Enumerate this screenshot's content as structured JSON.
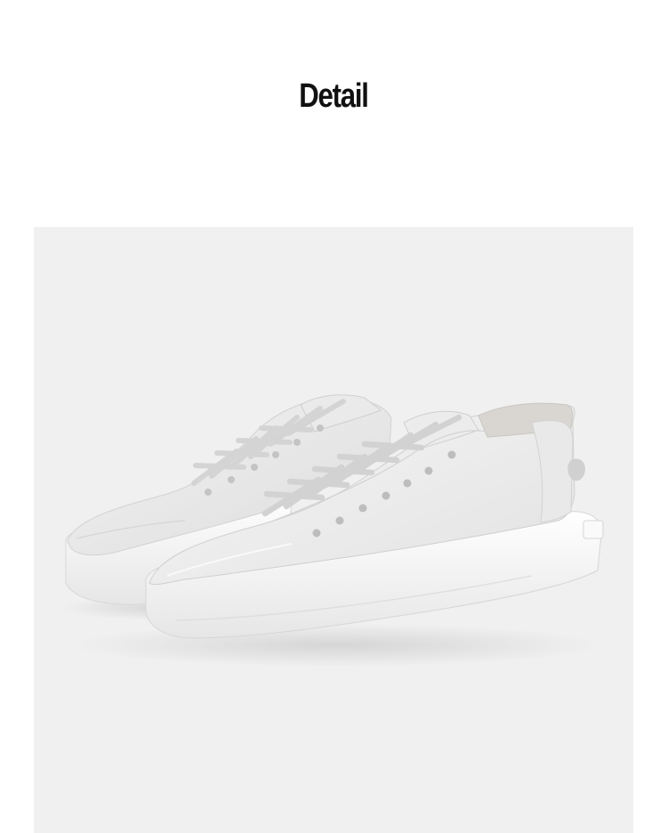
{
  "page": {
    "title": "Detail"
  },
  "product_image": {
    "subject": "pair-of-white-low-top-sneakers",
    "background_color": "#f0f0f0",
    "shoe_color": "#ececec",
    "sole_color": "#f7f7f7"
  }
}
